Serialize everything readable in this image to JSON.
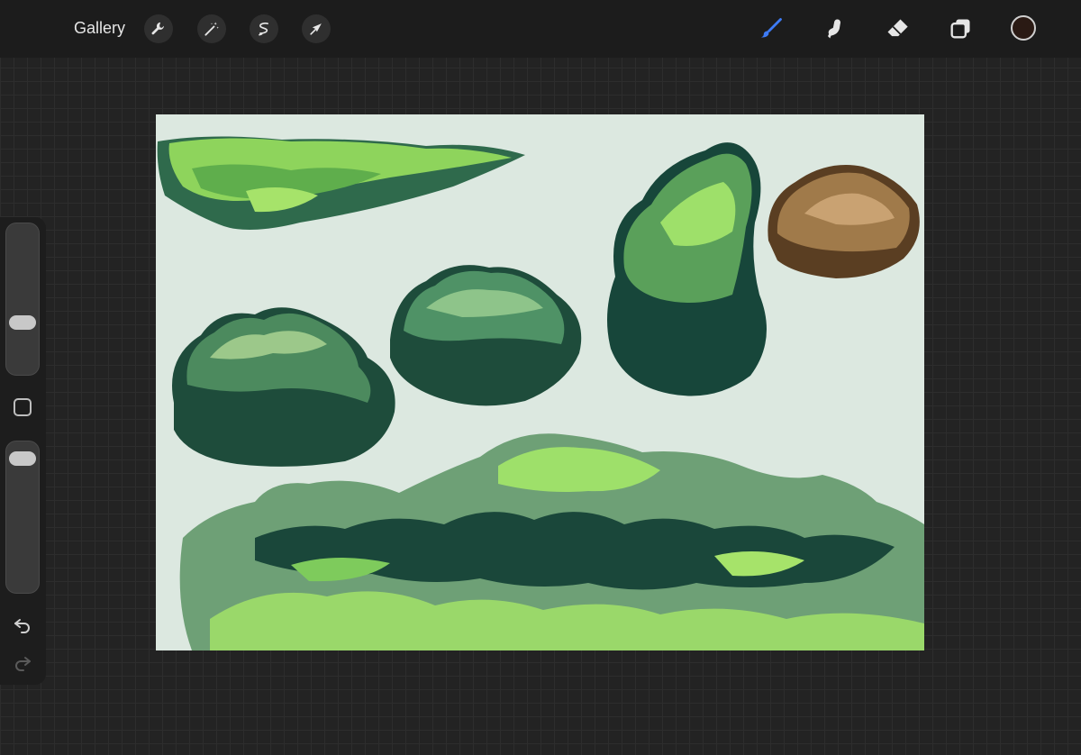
{
  "topbar": {
    "gallery_label": "Gallery",
    "left_tools": [
      "wrench-icon",
      "magic-wand-icon",
      "selection-icon",
      "transform-arrow-icon"
    ],
    "right_tools": [
      "brush-icon",
      "smudge-icon",
      "eraser-icon",
      "layers-icon"
    ],
    "active_tool": "brush-icon",
    "active_color": "#2a1a14"
  },
  "sidebar": {
    "brush_size_level": 0.33,
    "opacity_level": 0.95
  },
  "colors": {
    "accent": "#3d7bf6",
    "canvas_bg": "#dce8e0",
    "foliage_dark": "#1f4a3c",
    "foliage_mid": "#5a9a6a",
    "foliage_light": "#9ee06a",
    "bush_brown": "#9a7040"
  }
}
